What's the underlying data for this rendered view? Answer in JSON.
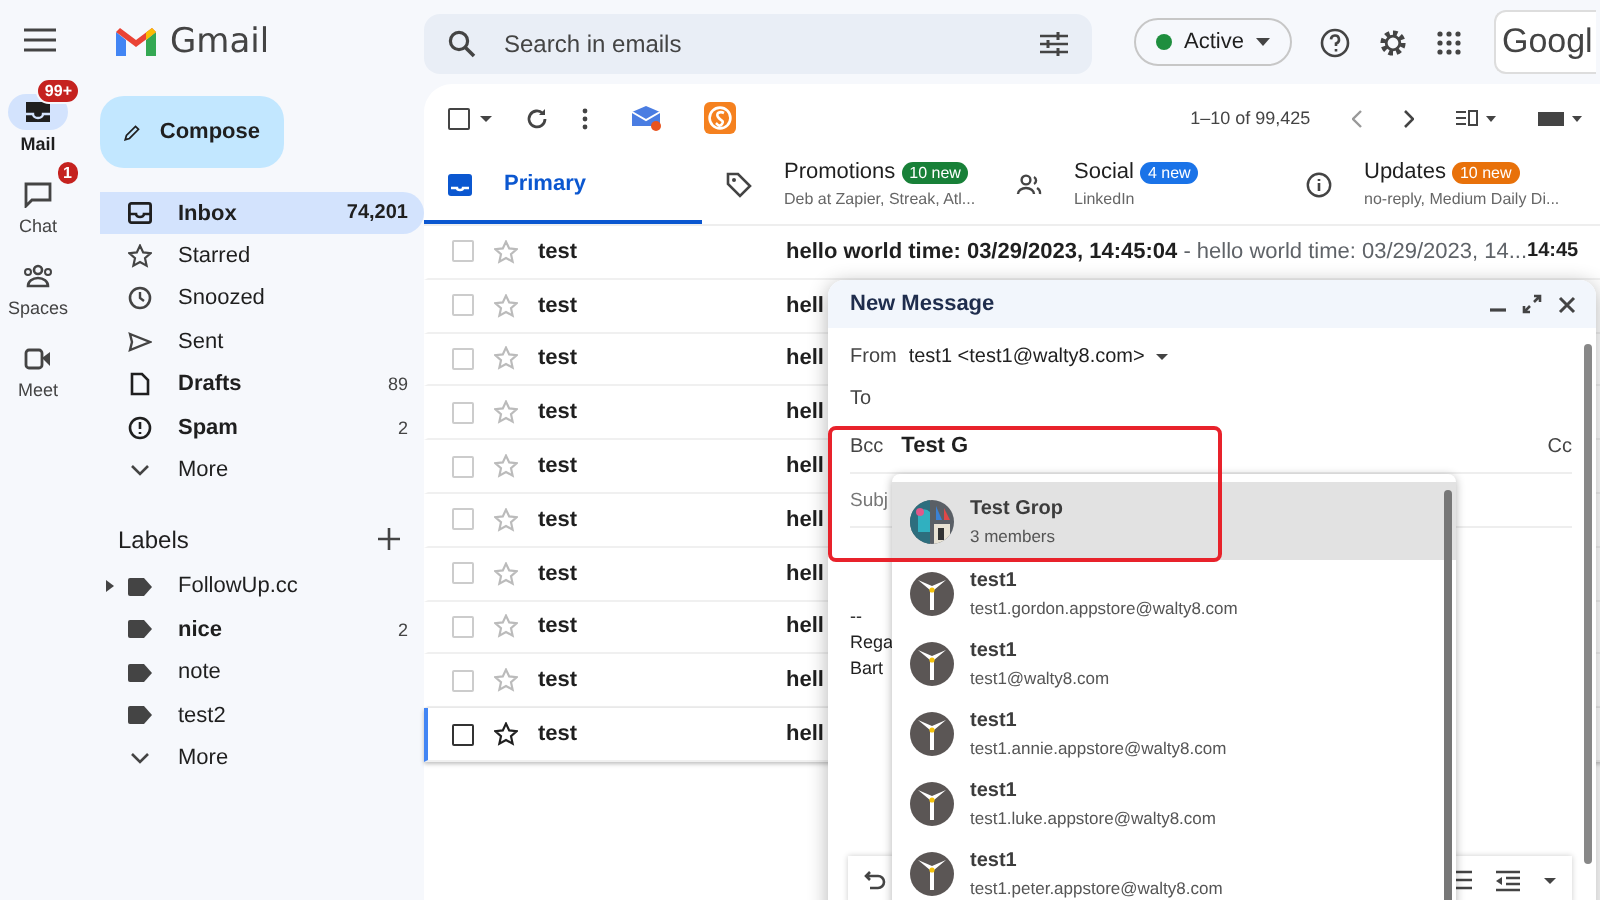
{
  "app": {
    "name": "Gmail"
  },
  "search": {
    "placeholder": "Search in emails"
  },
  "status": {
    "label": "Active",
    "color": "#1e8e3e"
  },
  "account": {
    "label": "Googl"
  },
  "rail": [
    {
      "label": "Mail",
      "selected": true,
      "badge": "99+"
    },
    {
      "label": "Chat",
      "selected": false,
      "badge": "1"
    },
    {
      "label": "Spaces",
      "selected": false
    },
    {
      "label": "Meet",
      "selected": false
    }
  ],
  "compose_button": "Compose",
  "folders": [
    {
      "label": "Inbox",
      "count": "74,201",
      "selected": true,
      "unread": true
    },
    {
      "label": "Starred",
      "selected": false,
      "unread": false
    },
    {
      "label": "Snoozed",
      "selected": false,
      "unread": false
    },
    {
      "label": "Sent",
      "selected": false,
      "unread": false
    },
    {
      "label": "Drafts",
      "count": "89",
      "selected": false,
      "unread": true
    },
    {
      "label": "Spam",
      "count": "2",
      "selected": false,
      "unread": true
    },
    {
      "label": "More",
      "selected": false,
      "unread": false
    }
  ],
  "labels": {
    "title": "Labels",
    "items": [
      {
        "label": "FollowUp.cc",
        "kind": "label",
        "expandable": true,
        "unread": false
      },
      {
        "label": "nice",
        "kind": "label",
        "expandable": false,
        "count": "2",
        "unread": true
      },
      {
        "label": "note",
        "kind": "label",
        "expandable": false,
        "unread": false
      },
      {
        "label": "test2",
        "kind": "label",
        "expandable": false,
        "unread": false
      },
      {
        "label": "More",
        "kind": "more",
        "expandable": false,
        "unread": false
      }
    ]
  },
  "select_all": {
    "checked": false
  },
  "pagination": "1–10 of 99,425",
  "tabs": [
    {
      "label": "Primary",
      "selected": true
    },
    {
      "label": "Promotions",
      "selected": false,
      "badge": "10 new",
      "color": "#188038",
      "senders": "Deb at Zapier, Streak, Atl..."
    },
    {
      "label": "Social",
      "selected": false,
      "badge": "4 new",
      "color": "#1a73e8",
      "senders": "LinkedIn"
    },
    {
      "label": "Updates",
      "selected": false,
      "badge": "10 new",
      "color": "#e8710a",
      "senders": "no-reply, Medium Daily Di..."
    }
  ],
  "emails": [
    {
      "sender": "test",
      "subject": "hello world time: 03/29/2023, 14:45:04",
      "snippet": " - hello world time: 03/29/2023, 14...",
      "time": "14:45",
      "focused": false
    },
    {
      "sender": "test",
      "subject": "hell",
      "focused": false
    },
    {
      "sender": "test",
      "subject": "hell",
      "focused": false
    },
    {
      "sender": "test",
      "subject": "hell",
      "focused": false
    },
    {
      "sender": "test",
      "subject": "hell",
      "focused": false
    },
    {
      "sender": "test",
      "subject": "hell",
      "focused": false
    },
    {
      "sender": "test",
      "subject": "hell",
      "focused": false
    },
    {
      "sender": "test",
      "subject": "hell",
      "focused": false
    },
    {
      "sender": "test",
      "subject": "hell",
      "focused": false
    },
    {
      "sender": "test",
      "subject": "hell",
      "focused": true
    }
  ],
  "compose": {
    "title": "New Message",
    "from_label": "From",
    "from": "test1 <test1@walty8.com>",
    "to_label": "To",
    "bcc_label": "Bcc",
    "bcc_value": "Test G",
    "cc_label": "Cc",
    "subject_placeholder": "Subj",
    "body": [
      "--",
      "Rega",
      "Bart"
    ]
  },
  "suggestions": [
    {
      "name": "Test Grop",
      "detail": "3 members",
      "kind": "group",
      "selected": true
    },
    {
      "name": "test1",
      "detail": "test1.gordon.appstore@walty8.com",
      "kind": "person",
      "selected": false
    },
    {
      "name": "test1",
      "detail": "test1@walty8.com",
      "kind": "person",
      "selected": false
    },
    {
      "name": "test1",
      "detail": "test1.annie.appstore@walty8.com",
      "kind": "person",
      "selected": false
    },
    {
      "name": "test1",
      "detail": "test1.luke.appstore@walty8.com",
      "kind": "person",
      "selected": false
    },
    {
      "name": "test1",
      "detail": "test1.peter.appstore@walty8.com",
      "kind": "person",
      "selected": false
    }
  ]
}
